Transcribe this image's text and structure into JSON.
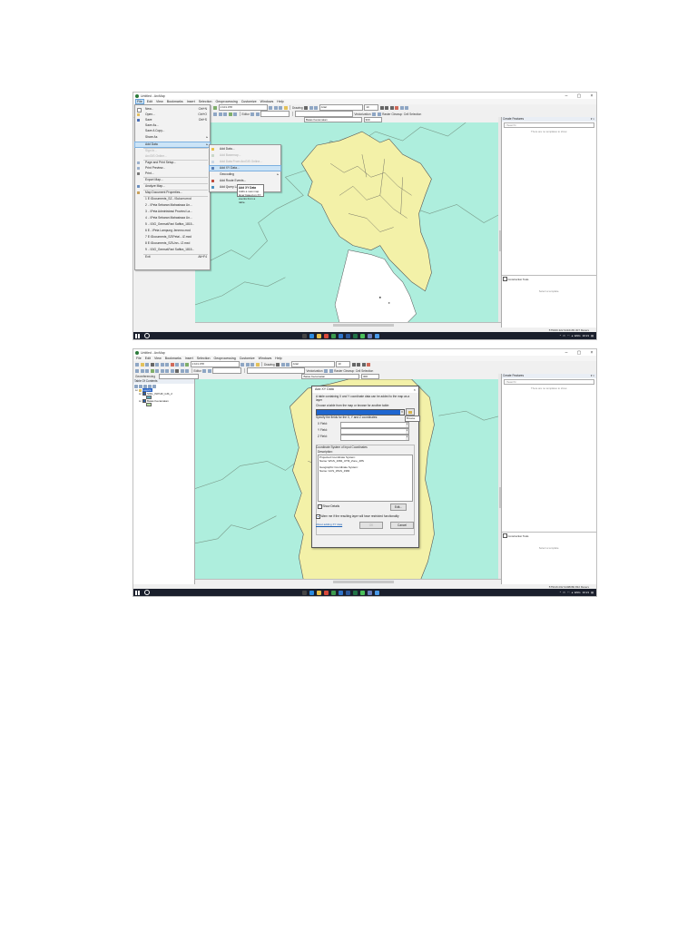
{
  "app": {
    "title": "Untitled - ArcMap",
    "menu": [
      "File",
      "Edit",
      "View",
      "Bookmarks",
      "Insert",
      "Selection",
      "Geoprocessing",
      "Customize",
      "Windows",
      "Help"
    ],
    "scale": "1:101.078",
    "drawing_label": "Drawing",
    "font_name": "Arial",
    "font_size": "10",
    "editor_label": "Editor",
    "vectorization_label": "Vectorization",
    "raster_cleanup_label": "Raster Cleanup",
    "cell_selection_label": "Cell Selection",
    "layer_combo": "Batas Kecamatan",
    "pct_combo": "300",
    "georef_label": "Georeferencing"
  },
  "toc": {
    "title": "Table Of Contents",
    "layers_label": "Layers",
    "layer1": "SIDL_INPUR_GIS_2",
    "layer2": "Batas Kecamatan"
  },
  "create_features": {
    "title": "Create Features",
    "search_placeholder": "<Search>",
    "empty_text": "There are no templates to show.",
    "tools_label": "Construction Tools",
    "select_template": "Select a template."
  },
  "shot1": {
    "coords": "575460.322  9416165.307 Meters",
    "file_menu": [
      {
        "label": "New...",
        "shortcut": "Ctrl+N"
      },
      {
        "label": "Open...",
        "shortcut": "Ctrl+O"
      },
      {
        "label": "Save",
        "shortcut": "Ctrl+S"
      },
      {
        "label": "Save As..."
      },
      {
        "label": "Save A Copy..."
      },
      {
        "label": "Share As"
      },
      {
        "label": "Add Data"
      },
      {
        "label": "Sign In..."
      },
      {
        "label": "ArcGIS Online..."
      },
      {
        "label": "Page and Print Setup..."
      },
      {
        "label": "Print Preview..."
      },
      {
        "label": "Print..."
      },
      {
        "label": "Export Map..."
      },
      {
        "label": "Analyze Map..."
      },
      {
        "label": "Map Document Properties..."
      },
      {
        "label": "1 E:\\Documents_SZ...\\Sukorn.mxd"
      },
      {
        "label": "2 ...\\Peta Sebaran Mahasiswa Un..."
      },
      {
        "label": "3 ...\\Peta Administrasi Provinsi La..."
      },
      {
        "label": "4 ...\\Peta Sebaran Mahasiswa Un..."
      },
      {
        "label": "5 ...\\SIG_Gemsa\\Fani Safitra_1815..."
      },
      {
        "label": "6 E...\\Peta Lampung Jenemo.mxd"
      },
      {
        "label": "7 E:\\Documents_SZ\\Peta\\...\\Z.mxd"
      },
      {
        "label": "8 E:\\Documents_SZ\\Unn...\\Z.mxd"
      },
      {
        "label": "9 ...\\SIG_Gemsa\\Fani Safitra_1815..."
      },
      {
        "label": "Exit",
        "shortcut": "Alt+F4"
      }
    ],
    "add_data_menu": [
      "Add Data...",
      "Add Basemap...",
      "Add Data From ArcGIS Online...",
      "Add XY Data...",
      "Geocoding",
      "Add Route Events...",
      "Add Query Layer..."
    ],
    "tooltip_title": "Add XY Data",
    "tooltip_text": "Adds a new map layer based on XY events from a table."
  },
  "shot2": {
    "coords": "575416.032  9408080.832 Meters",
    "dialog": {
      "title": "Add XY Data",
      "intro": "A table containing X and Y coordinate data can be added to the map as a layer",
      "choose_label": "Choose a table from the map or browse for another table:",
      "browse_tip": "Browse",
      "specify_label": "Specify the fields for the X, Y and Z coordinates:",
      "x_label": "X Field:",
      "y_label": "Y Field:",
      "z_label": "Z Field:",
      "coord_group": "Coordinate System of Input Coordinates",
      "description_label": "Description:",
      "description_text": "Projected Coordinate System:\n  Name: WGS_1984_UTM_Zone_48S\n\nGeographic Coordinate System:\n  Name: GCS_WGS_1984",
      "show_details": "Show Details",
      "edit_btn": "Edit...",
      "warn_label": "Warn me if the resulting layer will have restricted functionality",
      "about_link": "About adding XY data",
      "ok_btn": "OK",
      "cancel_btn": "Cancel"
    }
  },
  "taskbar": {
    "lang": "ENG",
    "time": "10:21"
  }
}
